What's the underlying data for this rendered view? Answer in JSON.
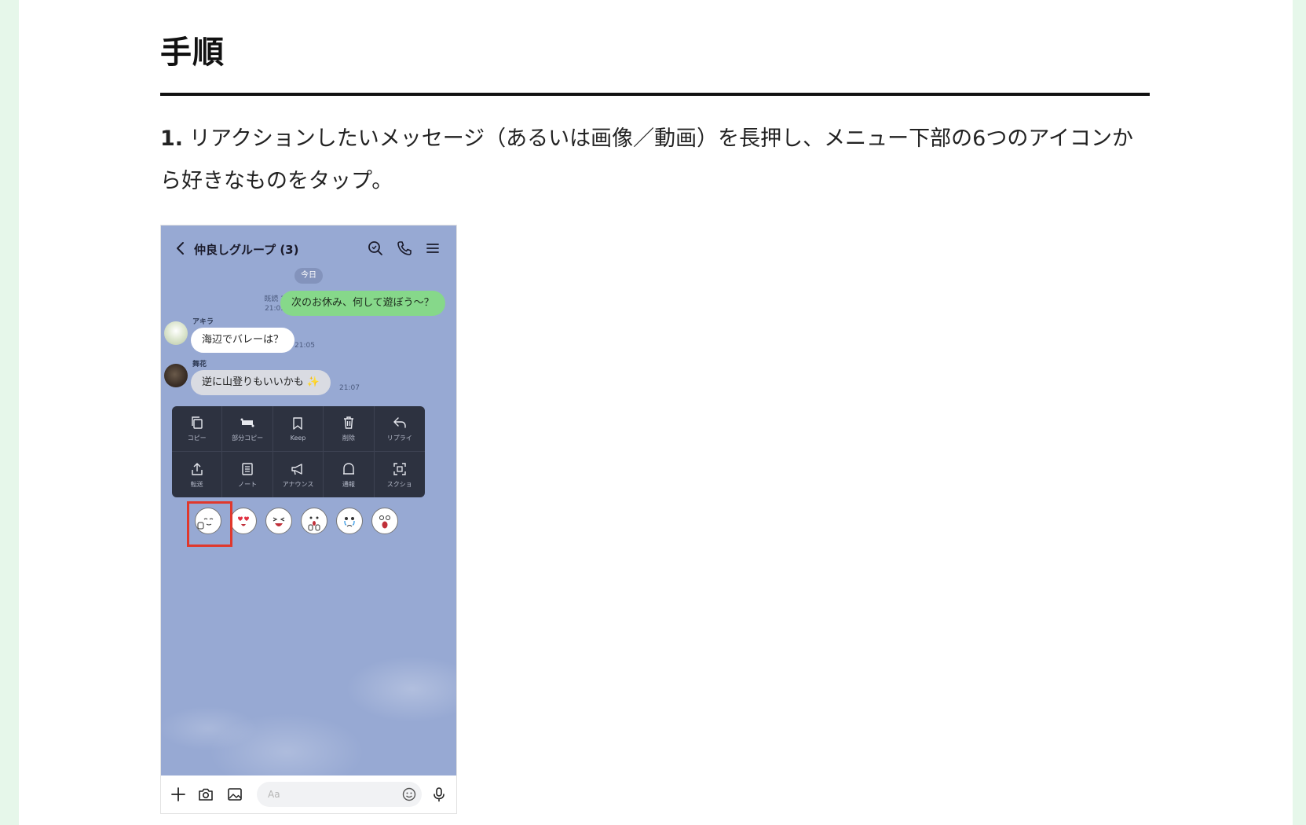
{
  "article": {
    "heading": "手順",
    "step": {
      "number": "1.",
      "text": "リアクションしたいメッセージ（あるいは画像／動画）を長押し、メニュー下部の6つのアイコンから好きなものをタップ。"
    }
  },
  "chat": {
    "title": "仲良しグループ (3)",
    "date_label": "今日",
    "messages": [
      {
        "sender": "",
        "text": "次のお休み、何して遊ぼう〜？",
        "read": "既読 2",
        "time": "21:03",
        "outgoing": true
      },
      {
        "sender": "アキラ",
        "text": "海辺でバレーは？",
        "time": "21:05",
        "outgoing": false
      },
      {
        "sender": "舞花",
        "text": "逆に山登りもいいかも ✨",
        "time": "21:07",
        "outgoing": false
      }
    ],
    "context_menu": [
      {
        "label": "コピー",
        "icon": "copy-icon"
      },
      {
        "label": "部分コピー",
        "icon": "partial-copy-icon"
      },
      {
        "label": "Keep",
        "icon": "bookmark-icon"
      },
      {
        "label": "削除",
        "icon": "trash-icon"
      },
      {
        "label": "リプライ",
        "icon": "reply-icon"
      },
      {
        "label": "転送",
        "icon": "share-icon"
      },
      {
        "label": "ノート",
        "icon": "note-icon"
      },
      {
        "label": "アナウンス",
        "icon": "megaphone-icon"
      },
      {
        "label": "通報",
        "icon": "report-icon"
      },
      {
        "label": "スクショ",
        "icon": "screenshot-icon"
      }
    ],
    "reactions": [
      "thumbs-up-face",
      "heart-eyes-face",
      "laughing-face",
      "surprised-hands-face",
      "crying-face",
      "shocked-face"
    ],
    "input_placeholder": "Aa"
  },
  "colors": {
    "chat_background": "#97a9d3",
    "outgoing_bubble": "#86d88a",
    "menu_background": "#2d3240",
    "highlight": "#e0382c"
  }
}
